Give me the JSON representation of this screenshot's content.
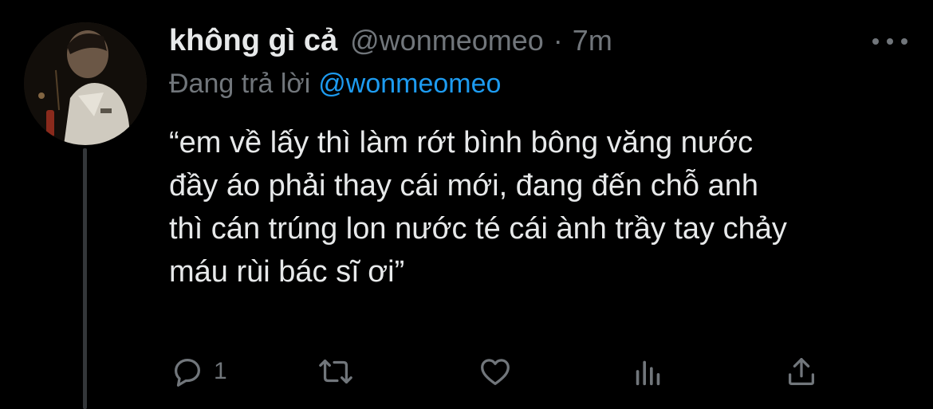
{
  "tweet": {
    "display_name": "không gì cả",
    "handle": "@wonmeomeo",
    "separator": "·",
    "time": "7m",
    "replying_to_label": "Đang trả lời",
    "replying_to_handle": "@wonmeomeo",
    "text_lines": [
      "“em về lấy thì làm rớt bình bông văng nước",
      "đầy áo phải thay cái mới, đang đến chỗ anh",
      "thì cán trúng lon nước té cái ành trầy tay chảy",
      "máu rùi bác sĩ ơi”"
    ],
    "reply_count": "1"
  },
  "icons": {
    "more": "more-horizontal-icon",
    "reply": "reply-icon",
    "retweet": "retweet-icon",
    "like": "like-heart-icon",
    "analytics": "analytics-icon",
    "share": "share-icon"
  },
  "colors": {
    "background": "#000000",
    "primary_text": "#e7e9ea",
    "secondary_text": "#71767b",
    "accent": "#1d9bf0",
    "thread_line": "#333639"
  }
}
